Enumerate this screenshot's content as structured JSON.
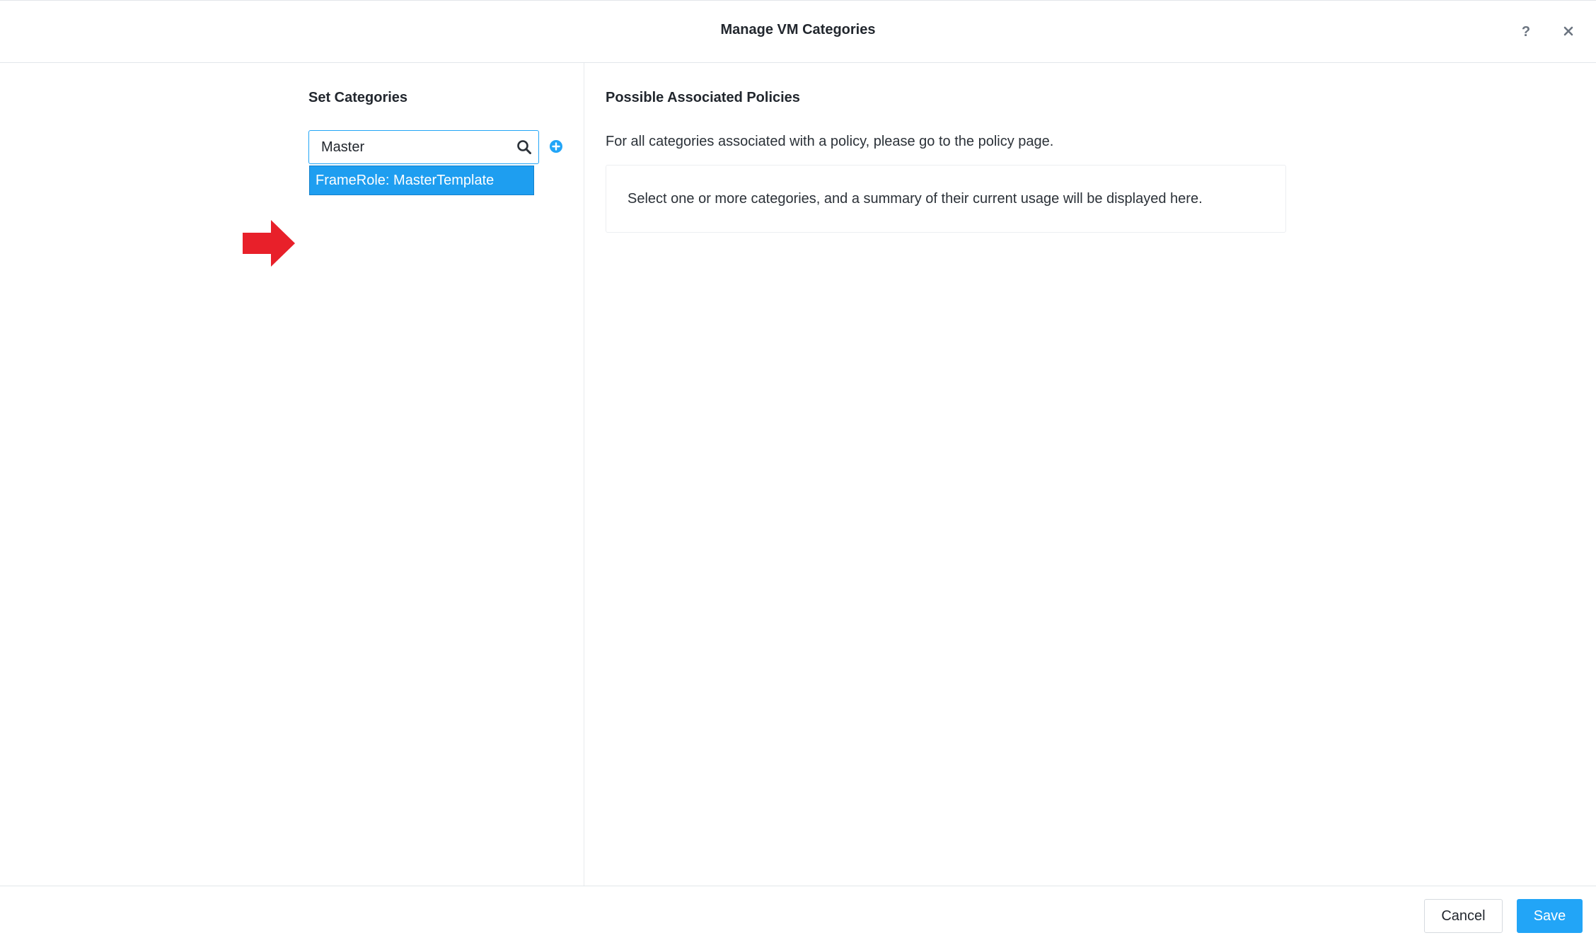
{
  "header": {
    "title": "Manage VM Categories",
    "help_icon": "question-mark-icon",
    "close_icon": "close-x-icon"
  },
  "left_panel": {
    "title": "Set Categories",
    "search": {
      "value": "Master",
      "icon": "search-icon"
    },
    "add_icon": "plus-circle-icon",
    "dropdown": {
      "items": [
        "FrameRole: MasterTemplate"
      ],
      "selected_index": 0
    },
    "annotation_arrow_color": "#e8202a"
  },
  "right_panel": {
    "title": "Possible Associated Policies",
    "description": "For all categories associated with a policy, please go to the policy page.",
    "info_text": "Select one or more categories, and a summary of their current usage will be displayed here."
  },
  "footer": {
    "cancel_label": "Cancel",
    "save_label": "Save"
  },
  "colors": {
    "accent": "#22a5f7",
    "selected_item": "#1e9ef0",
    "annotation": "#e8202a"
  }
}
